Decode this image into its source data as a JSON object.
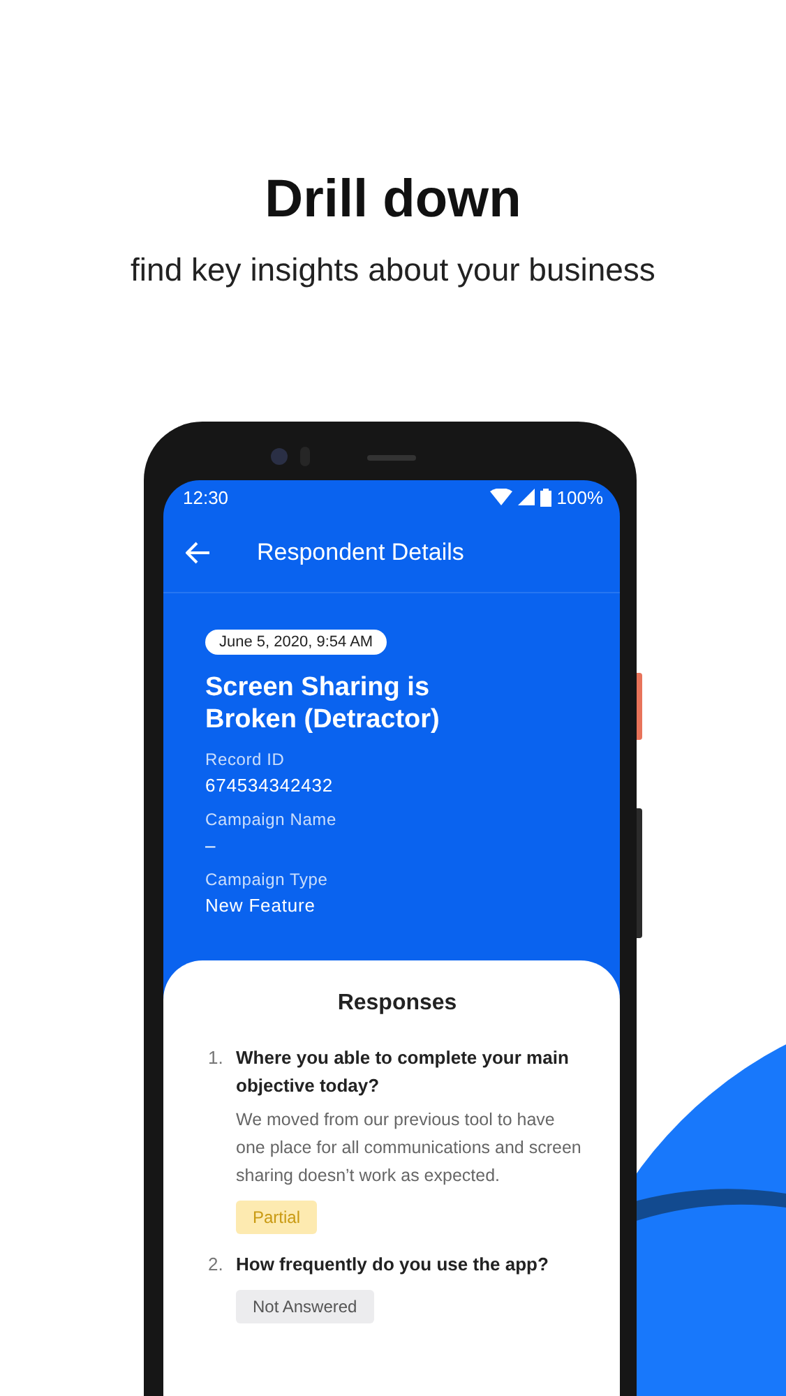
{
  "promo": {
    "headline": "Drill down",
    "subheadline": "find key insights about your business"
  },
  "status_bar": {
    "time": "12:30",
    "battery": "100%"
  },
  "app_bar": {
    "title": "Respondent Details"
  },
  "record": {
    "date": "June 5, 2020, 9:54 AM",
    "title": "Screen Sharing is Broken (Detractor)",
    "fields": [
      {
        "label": "Record ID",
        "value": "674534342432"
      },
      {
        "label": "Campaign Name",
        "value": "–"
      },
      {
        "label": "Campaign Type",
        "value": "New Feature"
      }
    ]
  },
  "responses": {
    "title": "Responses",
    "items": [
      {
        "number": "1.",
        "question": "Where you able to complete your main objective today?",
        "answer": "We moved from our previous tool to have one place for all communications and screen sharing doesn’t work as expected.",
        "status": "Partial",
        "kind": "partial"
      },
      {
        "number": "2.",
        "question": "How frequently do you use the app?",
        "status": "Not Answered",
        "kind": "unanswered"
      }
    ]
  }
}
